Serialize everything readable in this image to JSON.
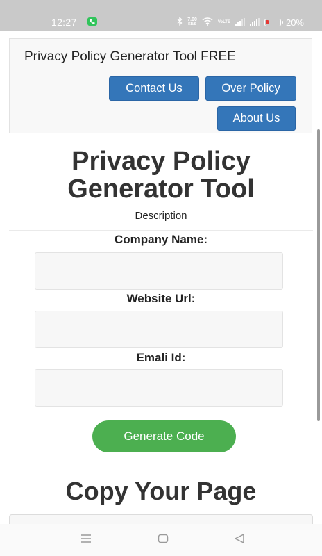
{
  "status_bar": {
    "time": "12:27",
    "network_speed_value": "7.00",
    "network_speed_unit": "KB/S",
    "volte_label": "VoLTE",
    "battery_percent": "20%",
    "battery_level": 0.2,
    "icons": [
      "call-icon",
      "bluetooth-icon",
      "wifi-icon",
      "signal-icon",
      "battery-icon"
    ]
  },
  "navbar": {
    "brand": "Privacy Policy Generator Tool FREE",
    "buttons": {
      "contact": "Contact Us",
      "over_policy": "Over Policy",
      "about": "About Us"
    }
  },
  "main": {
    "title_line1": "Privacy Policy",
    "title_line2": "Generator Tool",
    "description": "Description",
    "form": {
      "company_label": "Company Name:",
      "company_value": "",
      "website_label": "Website Url:",
      "website_value": "",
      "email_label": "Emali Id:",
      "email_value": "",
      "generate_label": "Generate Code"
    },
    "copy_title": "Copy Your Page"
  },
  "colors": {
    "primary_button": "#3476b9",
    "generate_button": "#4caf50",
    "status_bar_bg": "#c9c9c9"
  },
  "nav_bar": {
    "icons": [
      "menu-icon",
      "home-icon",
      "back-icon"
    ]
  }
}
